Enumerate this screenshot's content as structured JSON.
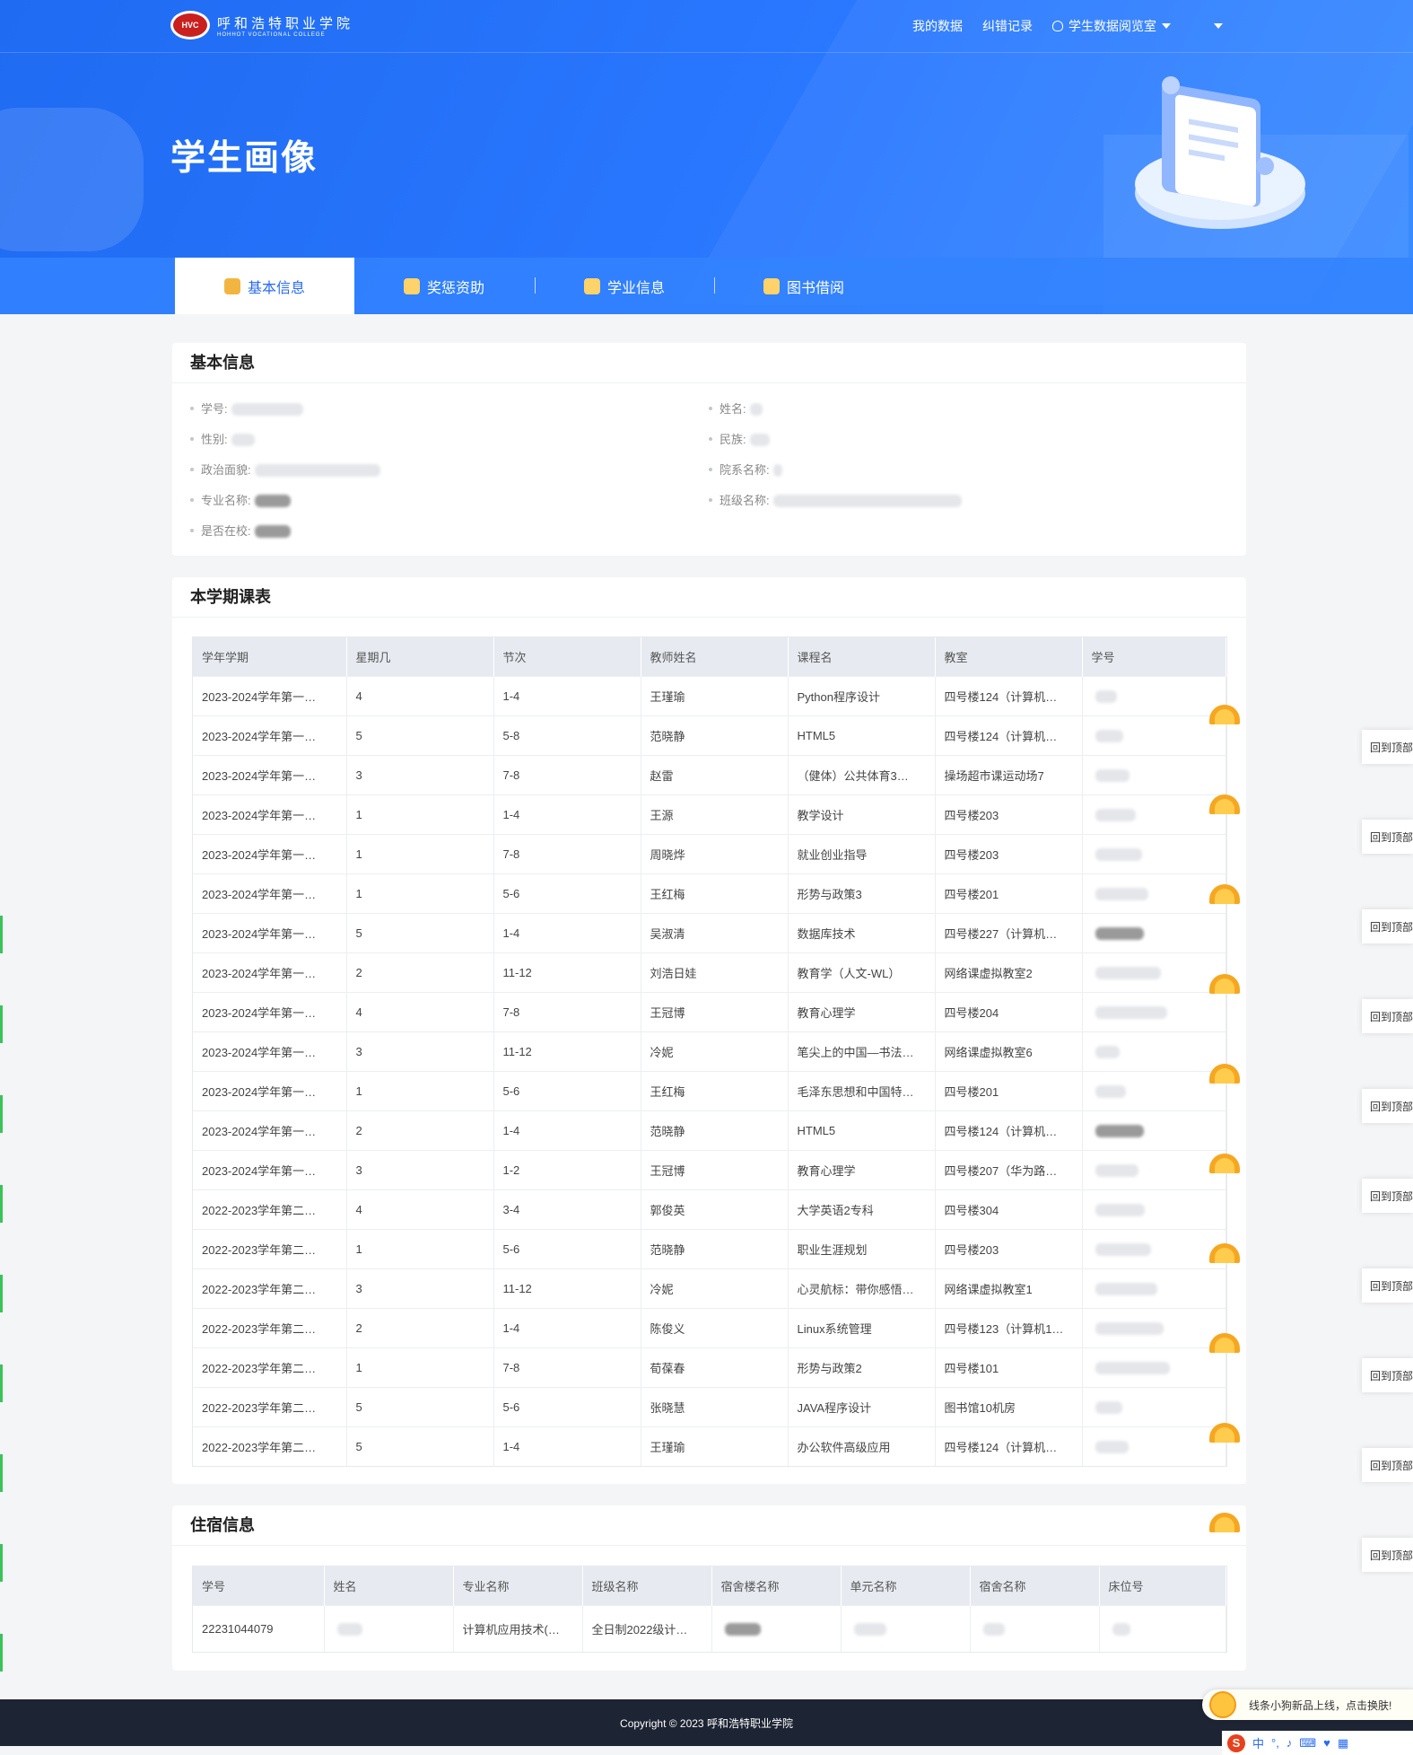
{
  "header": {
    "logo": {
      "cn": "呼和浩特职业学院",
      "en": "HOHHOT VOCATIONAL COLLEGE"
    },
    "nav": [
      {
        "label": "我的数据"
      },
      {
        "label": "纠错记录"
      },
      {
        "label": "学生数据阅览室"
      }
    ],
    "page_title": "学生画像"
  },
  "tabs": [
    {
      "label": "基本信息",
      "active": true
    },
    {
      "label": "奖惩资助",
      "active": false
    },
    {
      "label": "学业信息",
      "active": false
    },
    {
      "label": "图书借阅",
      "active": false
    }
  ],
  "basic_info": {
    "title": "基本信息",
    "fields": {
      "student_id": "学号:",
      "name": "姓名:",
      "gender": "性别:",
      "ethnicity": "民族:",
      "political": "政治面貌:",
      "department": "院系名称:",
      "major": "专业名称:",
      "class": "班级名称:",
      "enrolled": "是否在校:"
    }
  },
  "schedule": {
    "title": "本学期课表",
    "columns": [
      "学年学期",
      "星期几",
      "节次",
      "教师姓名",
      "课程名",
      "教室",
      "学号"
    ],
    "rows": [
      [
        "2023-2024学年第一…",
        "4",
        "1-4",
        "王瑾瑜",
        "Python程序设计",
        "四号楼124（计算机…"
      ],
      [
        "2023-2024学年第一…",
        "5",
        "5-8",
        "范晓静",
        "HTML5",
        "四号楼124（计算机…"
      ],
      [
        "2023-2024学年第一…",
        "3",
        "7-8",
        "赵雷",
        "（健体）公共体育3…",
        "操场超市课运动场7"
      ],
      [
        "2023-2024学年第一…",
        "1",
        "1-4",
        "王源",
        "教学设计",
        "四号楼203"
      ],
      [
        "2023-2024学年第一…",
        "1",
        "7-8",
        "周晓烨",
        "就业创业指导",
        "四号楼203"
      ],
      [
        "2023-2024学年第一…",
        "1",
        "5-6",
        "王红梅",
        "形势与政策3",
        "四号楼201"
      ],
      [
        "2023-2024学年第一…",
        "5",
        "1-4",
        "吴淑清",
        "数据库技术",
        "四号楼227（计算机…"
      ],
      [
        "2023-2024学年第一…",
        "2",
        "11-12",
        "刘浩日娃",
        "教育学（人文-WL）",
        "网络课虚拟教室2"
      ],
      [
        "2023-2024学年第一…",
        "4",
        "7-8",
        "王冠博",
        "教育心理学",
        "四号楼204"
      ],
      [
        "2023-2024学年第一…",
        "3",
        "11-12",
        "冷妮",
        "笔尖上的中国—书法…",
        "网络课虚拟教室6"
      ],
      [
        "2023-2024学年第一…",
        "1",
        "5-6",
        "王红梅",
        "毛泽东思想和中国特…",
        "四号楼201"
      ],
      [
        "2023-2024学年第一…",
        "2",
        "1-4",
        "范晓静",
        "HTML5",
        "四号楼124（计算机…"
      ],
      [
        "2023-2024学年第一…",
        "3",
        "1-2",
        "王冠博",
        "教育心理学",
        "四号楼207（华为路…"
      ],
      [
        "2022-2023学年第二…",
        "4",
        "3-4",
        "郭俊英",
        "大学英语2专科",
        "四号楼304"
      ],
      [
        "2022-2023学年第二…",
        "1",
        "5-6",
        "范晓静",
        "职业生涯规划",
        "四号楼203"
      ],
      [
        "2022-2023学年第二…",
        "3",
        "11-12",
        "冷妮",
        "心灵航标：带你感悟…",
        "网络课虚拟教室1"
      ],
      [
        "2022-2023学年第二…",
        "2",
        "1-4",
        "陈俊义",
        "Linux系统管理",
        "四号楼123（计算机1…"
      ],
      [
        "2022-2023学年第二…",
        "1",
        "7-8",
        "荀葆春",
        "形势与政策2",
        "四号楼101"
      ],
      [
        "2022-2023学年第二…",
        "5",
        "5-6",
        "张晓慧",
        "JAVA程序设计",
        "图书馆10机房"
      ],
      [
        "2022-2023学年第二…",
        "5",
        "1-4",
        "王瑾瑜",
        "办公软件高级应用",
        "四号楼124（计算机…"
      ]
    ]
  },
  "dorm": {
    "title": "住宿信息",
    "columns": [
      "学号",
      "姓名",
      "专业名称",
      "班级名称",
      "宿舍楼名称",
      "单元名称",
      "宿舍名称",
      "床位号"
    ],
    "row": [
      "22231044079",
      "",
      "计算机应用技术(…",
      "全日制2022级计…",
      "",
      "",
      "",
      ""
    ]
  },
  "footer": {
    "copyright": "Copyright © 2023 呼和浩特职业学院"
  },
  "overlay": {
    "back_to_top": "回到顶部",
    "promo": "线条小狗新品上线，点击换肤!",
    "ime_mode": "中"
  }
}
